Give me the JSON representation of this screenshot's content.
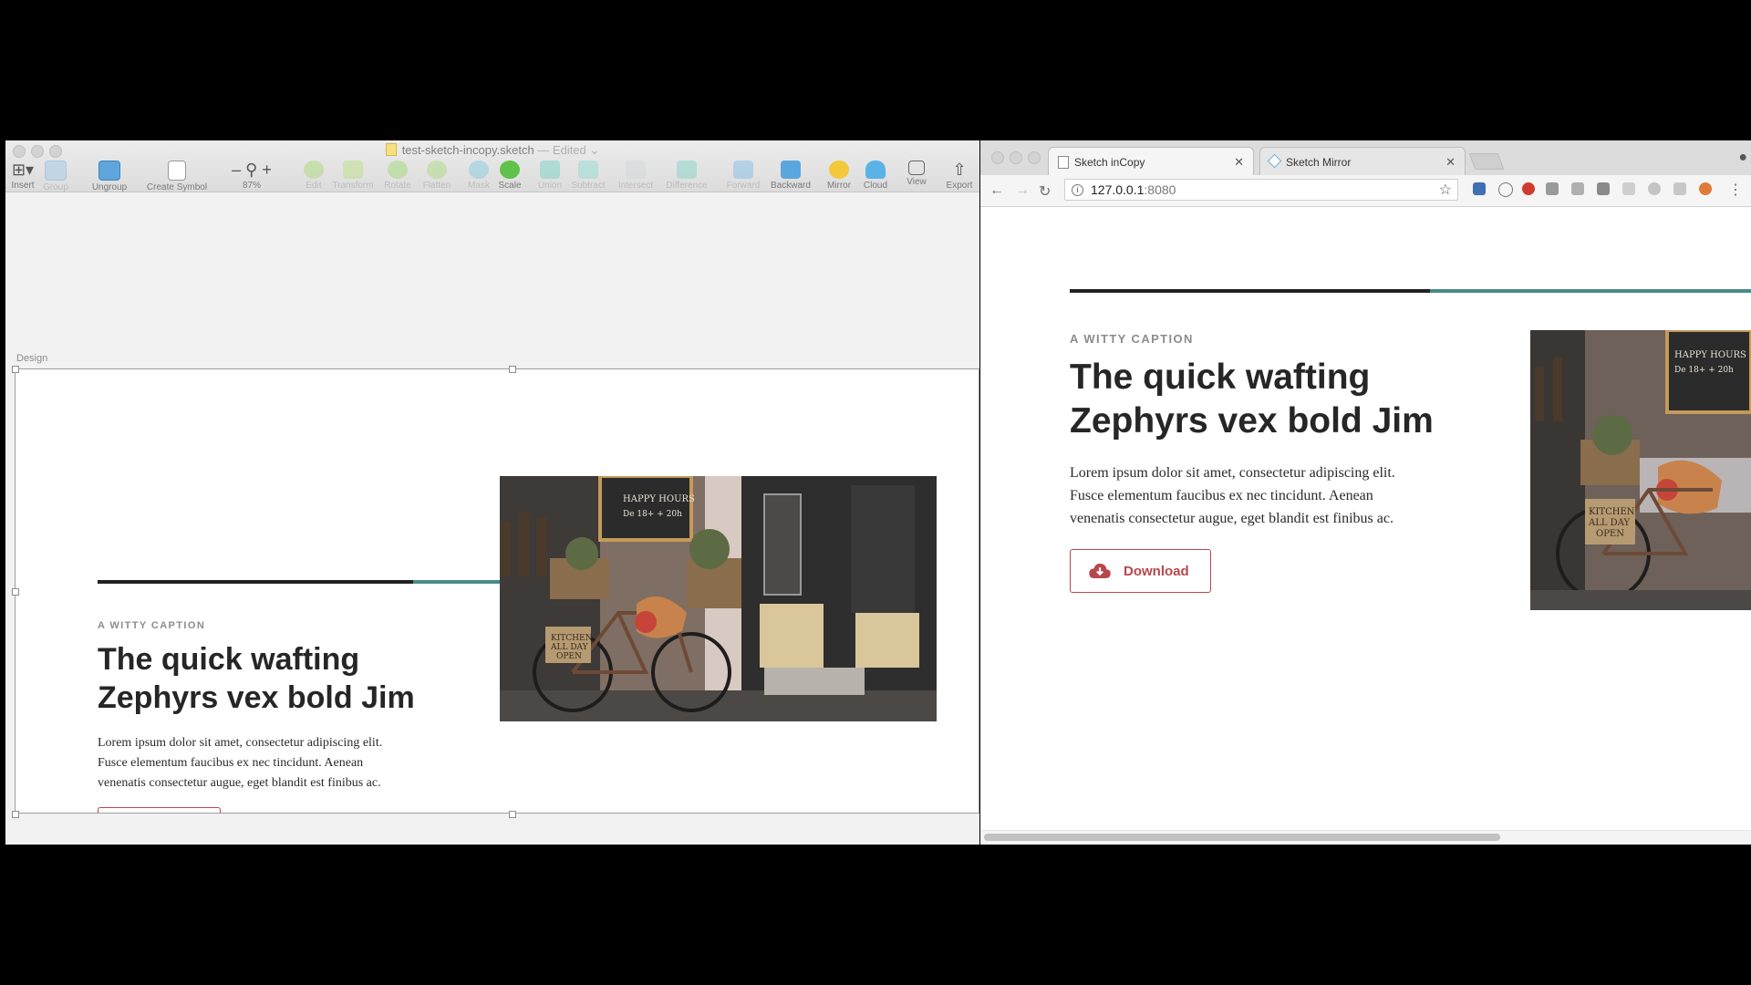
{
  "sketch": {
    "title": "test-sketch-incopy.sketch",
    "edited": "— Edited ",
    "tools": {
      "insert": "Insert",
      "group": "Group",
      "ungroup": "Ungroup",
      "create_symbol": "Create Symbol",
      "zoom": "87%",
      "edit": "Edit",
      "transform": "Transform",
      "rotate": "Rotate",
      "flatten": "Flatten",
      "mask": "Mask",
      "scale": "Scale",
      "union": "Union",
      "subtract": "Subtract",
      "intersect": "Intersect",
      "difference": "Difference",
      "forward": "Forward",
      "backward": "Backward",
      "mirror": "Mirror",
      "cloud": "Cloud",
      "view": "View",
      "export": "Export"
    },
    "artboard_label": "Design"
  },
  "card": {
    "caption": "A WITTY CAPTION",
    "headline_line1": "The quick wafting",
    "headline_line2": "Zephyrs vex bold Jim",
    "body_line1": "Lorem ipsum dolor sit amet, consectetur adipiscing elit.",
    "body_line2": "Fusce elementum faucibus ex nec tincidunt. Aenean",
    "body_line3": "venenatis consectetur augue, eget blandit est finibus ac.",
    "button_label": "Download",
    "photo_signs": {
      "chalkboard": "HAPPY HOURS",
      "chalkboard_sub": "De 18+ + 20h",
      "bike_sign_1": "KITCHEN",
      "bike_sign_2": "ALL DAY",
      "bike_sign_3": "OPEN"
    },
    "colors": {
      "dark": "#222222",
      "teal": "#4a8a88",
      "red": "#b0353f",
      "button": "#b8474c"
    }
  },
  "chrome": {
    "tabs": [
      {
        "label": "Sketch inCopy"
      },
      {
        "label": "Sketch Mirror"
      }
    ],
    "url_host": "127.0.0.1",
    "url_port": ":8080"
  }
}
